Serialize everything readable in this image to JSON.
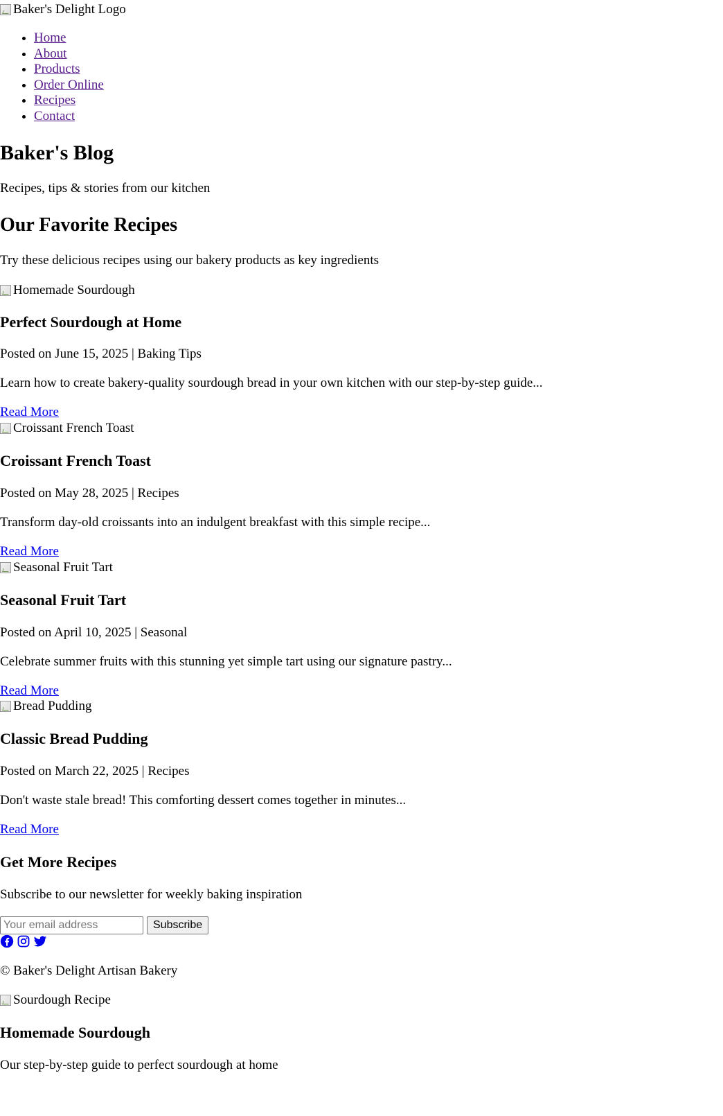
{
  "header": {
    "logo_alt": "Baker's Delight Logo",
    "nav": [
      "Home",
      "About",
      "Products",
      "Order Online",
      "Recipes",
      "Contact"
    ]
  },
  "page": {
    "title": "Baker's Blog",
    "tagline": "Recipes, tips & stories from our kitchen"
  },
  "section": {
    "title": "Our Favorite Recipes",
    "subtitle": "Try these delicious recipes using our bakery products as key ingredients"
  },
  "posts": [
    {
      "image_alt": "Homemade Sourdough",
      "title": "Perfect Sourdough at Home",
      "meta": "Posted on June 15, 2025 | Baking Tips",
      "excerpt": "Learn how to create bakery-quality sourdough bread in your own kitchen with our step-by-step guide...",
      "link": "Read More"
    },
    {
      "image_alt": "Croissant French Toast",
      "title": "Croissant French Toast",
      "meta": "Posted on May 28, 2025 | Recipes",
      "excerpt": "Transform day-old croissants into an indulgent breakfast with this simple recipe...",
      "link": "Read More"
    },
    {
      "image_alt": "Seasonal Fruit Tart",
      "title": "Seasonal Fruit Tart",
      "meta": "Posted on April 10, 2025 | Seasonal",
      "excerpt": "Celebrate summer fruits with this stunning yet simple tart using our signature pastry...",
      "link": "Read More"
    },
    {
      "image_alt": "Bread Pudding",
      "title": "Classic Bread Pudding",
      "meta": "Posted on March 22, 2025 | Recipes",
      "excerpt": "Don't waste stale bread! This comforting dessert comes together in minutes...",
      "link": "Read More"
    }
  ],
  "newsletter": {
    "title": "Get More Recipes",
    "text": "Subscribe to our newsletter for weekly baking inspiration",
    "placeholder": "Your email address",
    "button": "Subscribe"
  },
  "social": {
    "icons": [
      "facebook-icon",
      "instagram-icon",
      "twitter-icon"
    ],
    "color": "#0000ee"
  },
  "footer": {
    "copyright": "© Baker's Delight Artisan Bakery"
  },
  "featured": {
    "image_alt": "Sourdough Recipe",
    "title": "Homemade Sourdough",
    "text": "Our step-by-step guide to perfect sourdough at home"
  }
}
